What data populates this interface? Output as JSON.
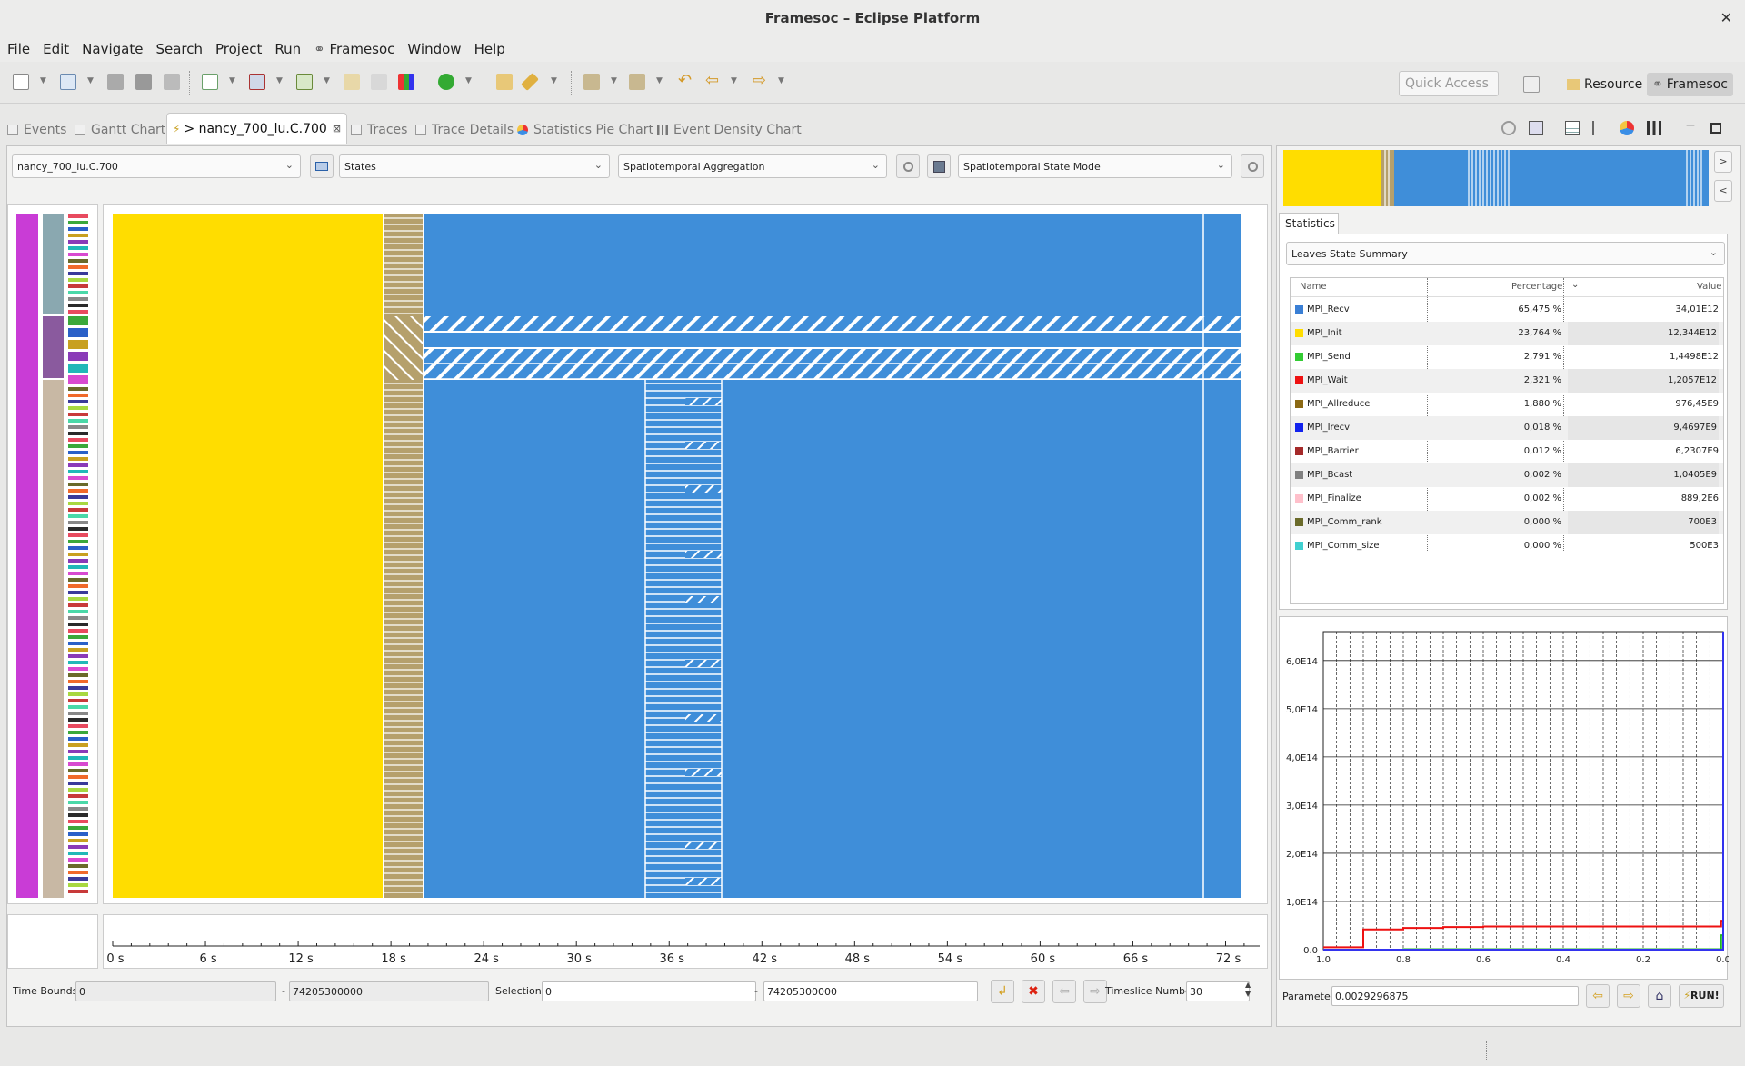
{
  "window": {
    "title": "Framesoc – Eclipse Platform"
  },
  "menu": [
    "File",
    "Edit",
    "Navigate",
    "Search",
    "Project",
    "Run",
    "Framesoc",
    "Window",
    "Help"
  ],
  "toolbar": {
    "quick_access_placeholder": "Quick Access",
    "perspectives": [
      "Resource",
      "Framesoc"
    ]
  },
  "tabs": [
    "Events",
    "Gantt Chart",
    "> nancy_700_lu.C.700",
    "Traces",
    "Trace Details",
    "Statistics Pie Chart",
    "Event Density Chart"
  ],
  "controls": {
    "trace_combo": "nancy_700_lu.C.700",
    "type_combo": "States",
    "aggregation_combo": "Spatiotemporal Aggregation",
    "mode_combo": "Spatiotemporal State Mode"
  },
  "time_axis": {
    "ticks": [
      "0 s",
      "6 s",
      "12 s",
      "18 s",
      "24 s",
      "30 s",
      "36 s",
      "42 s",
      "48 s",
      "54 s",
      "60 s",
      "66 s",
      "72 s"
    ],
    "max_seconds": 74.2053
  },
  "aggregation_plot": {
    "colors": {
      "init": "#ffdd00",
      "recv": "#3f8ed9",
      "allreduce": "#b5a06c"
    },
    "init_until_s": 17.3,
    "recv_after_s": 19.8
  },
  "bottom": {
    "time_bounds_label": "Time Bounds:",
    "time_start": "0",
    "time_end": "74205300000",
    "selection_label": "Selection:",
    "selection_start": "0",
    "selection_end": "74205300000",
    "timeslice_label": "Timeslice Number",
    "timeslice_value": "30",
    "dash": "-"
  },
  "statistics": {
    "tab": "Statistics",
    "summary_combo": "Leaves State Summary",
    "headers": {
      "name": "Name",
      "percentage": "Percentage",
      "value": "Value"
    },
    "rows": [
      {
        "name": "MPI_Recv",
        "percentage": "65,475 %",
        "value": "34,01E12",
        "color": "#3a7fd5"
      },
      {
        "name": "MPI_Init",
        "percentage": "23,764 %",
        "value": "12,344E12",
        "color": "#ffdd00"
      },
      {
        "name": "MPI_Send",
        "percentage": "2,791 %",
        "value": "1,4498E12",
        "color": "#33cc33"
      },
      {
        "name": "MPI_Wait",
        "percentage": "2,321 %",
        "value": "1,2057E12",
        "color": "#ee1111"
      },
      {
        "name": "MPI_Allreduce",
        "percentage": "1,880 %",
        "value": "976,45E9",
        "color": "#8b6914"
      },
      {
        "name": "MPI_Irecv",
        "percentage": "0,018 %",
        "value": "9,4697E9",
        "color": "#1122ee"
      },
      {
        "name": "MPI_Barrier",
        "percentage": "0,012 %",
        "value": "6,2307E9",
        "color": "#a52a2a"
      },
      {
        "name": "MPI_Bcast",
        "percentage": "0,002 %",
        "value": "1,0405E9",
        "color": "#808080"
      },
      {
        "name": "MPI_Finalize",
        "percentage": "0,002 %",
        "value": "889,2E6",
        "color": "#ffc0cb"
      },
      {
        "name": "MPI_Comm_rank",
        "percentage": "0,000 %",
        "value": "700E3",
        "color": "#6b6b2a"
      },
      {
        "name": "MPI_Comm_size",
        "percentage": "0,000 %",
        "value": "500E3",
        "color": "#40d0d0"
      }
    ]
  },
  "curve_chart": {
    "y_ticks": [
      "6,0E14",
      "5,0E14",
      "4,0E14",
      "3,0E14",
      "2,0E14",
      "1,0E14",
      "0.0"
    ],
    "x_ticks": [
      "1.0",
      "0.8",
      "0.6",
      "0.4",
      "0.2",
      "0.0"
    ],
    "parameter_label": "Parameter",
    "parameter_value": "0.0029296875",
    "run_label": "RUN!"
  },
  "chart_data": {
    "type": "line",
    "x": [
      1.0,
      0.9,
      0.8,
      0.7,
      0.6,
      0.5,
      0.4,
      0.3,
      0.2,
      0.1,
      0.02,
      0.005,
      0.0
    ],
    "series": [
      {
        "color": "#ee1111",
        "values": [
          5000000000000.0,
          42000000000000.0,
          45000000000000.0,
          47000000000000.0,
          48000000000000.0,
          48000000000000.0,
          48000000000000.0,
          48000000000000.0,
          48000000000000.0,
          48000000000000.0,
          48000000000000.0,
          60000000000000.0,
          70000000000000.0
        ]
      },
      {
        "color": "#22bb22",
        "values": [
          0.0,
          0.0,
          1000000000000.0,
          1000000000000.0,
          1000000000000.0,
          1000000000000.0,
          1000000000000.0,
          1000000000000.0,
          1000000000000.0,
          1000000000000.0,
          1000000000000.0,
          30000000000000.0,
          570000000000000.0
        ]
      },
      {
        "color": "#3333ee",
        "values": [
          0.0,
          0.0,
          0.0,
          0.0,
          0.0,
          0.0,
          0.0,
          0.0,
          0.0,
          0.0,
          0.0,
          0.0,
          660000000000000.0
        ]
      }
    ],
    "ylim": [
      0,
      660000000000000.0
    ],
    "xlim": [
      1.0,
      0.0
    ],
    "grid": true
  }
}
